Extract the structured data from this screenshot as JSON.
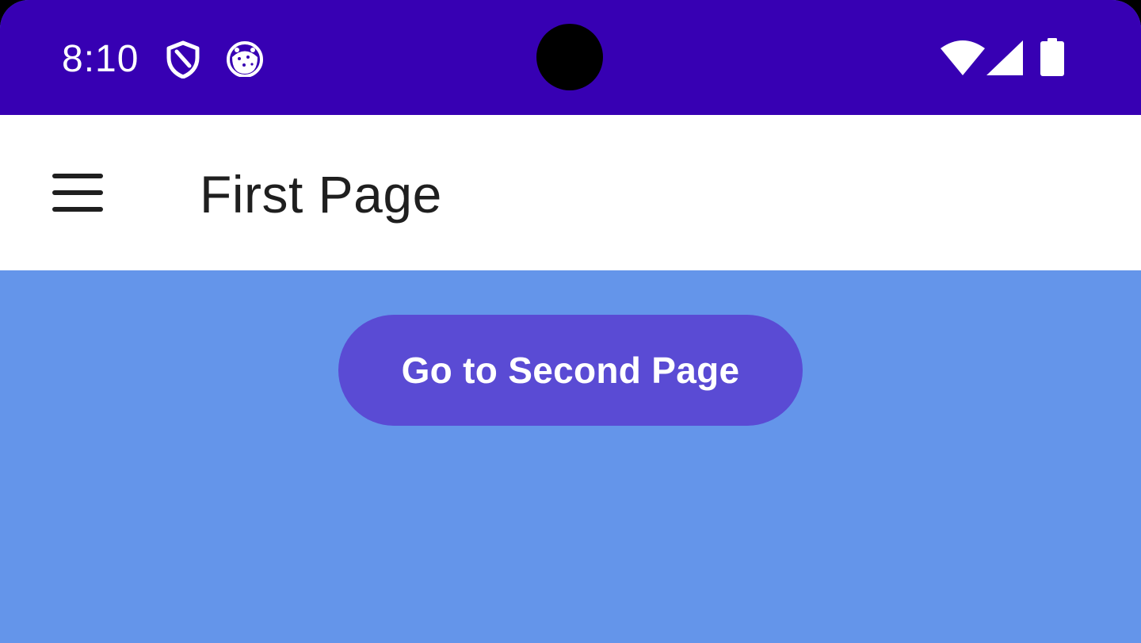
{
  "status_bar": {
    "time": "8:10",
    "left_icons": [
      "shield-icon",
      "cookie-icon"
    ],
    "right_icons": [
      "wifi-icon",
      "signal-icon",
      "battery-icon"
    ],
    "background_color": "#3700b3"
  },
  "app_bar": {
    "menu_icon": "menu-icon",
    "title": "First Page",
    "background_color": "#ffffff"
  },
  "content": {
    "background_color": "#6495ea",
    "primary_button_label": "Go to Second Page",
    "primary_button_color": "#5a4bd4"
  }
}
